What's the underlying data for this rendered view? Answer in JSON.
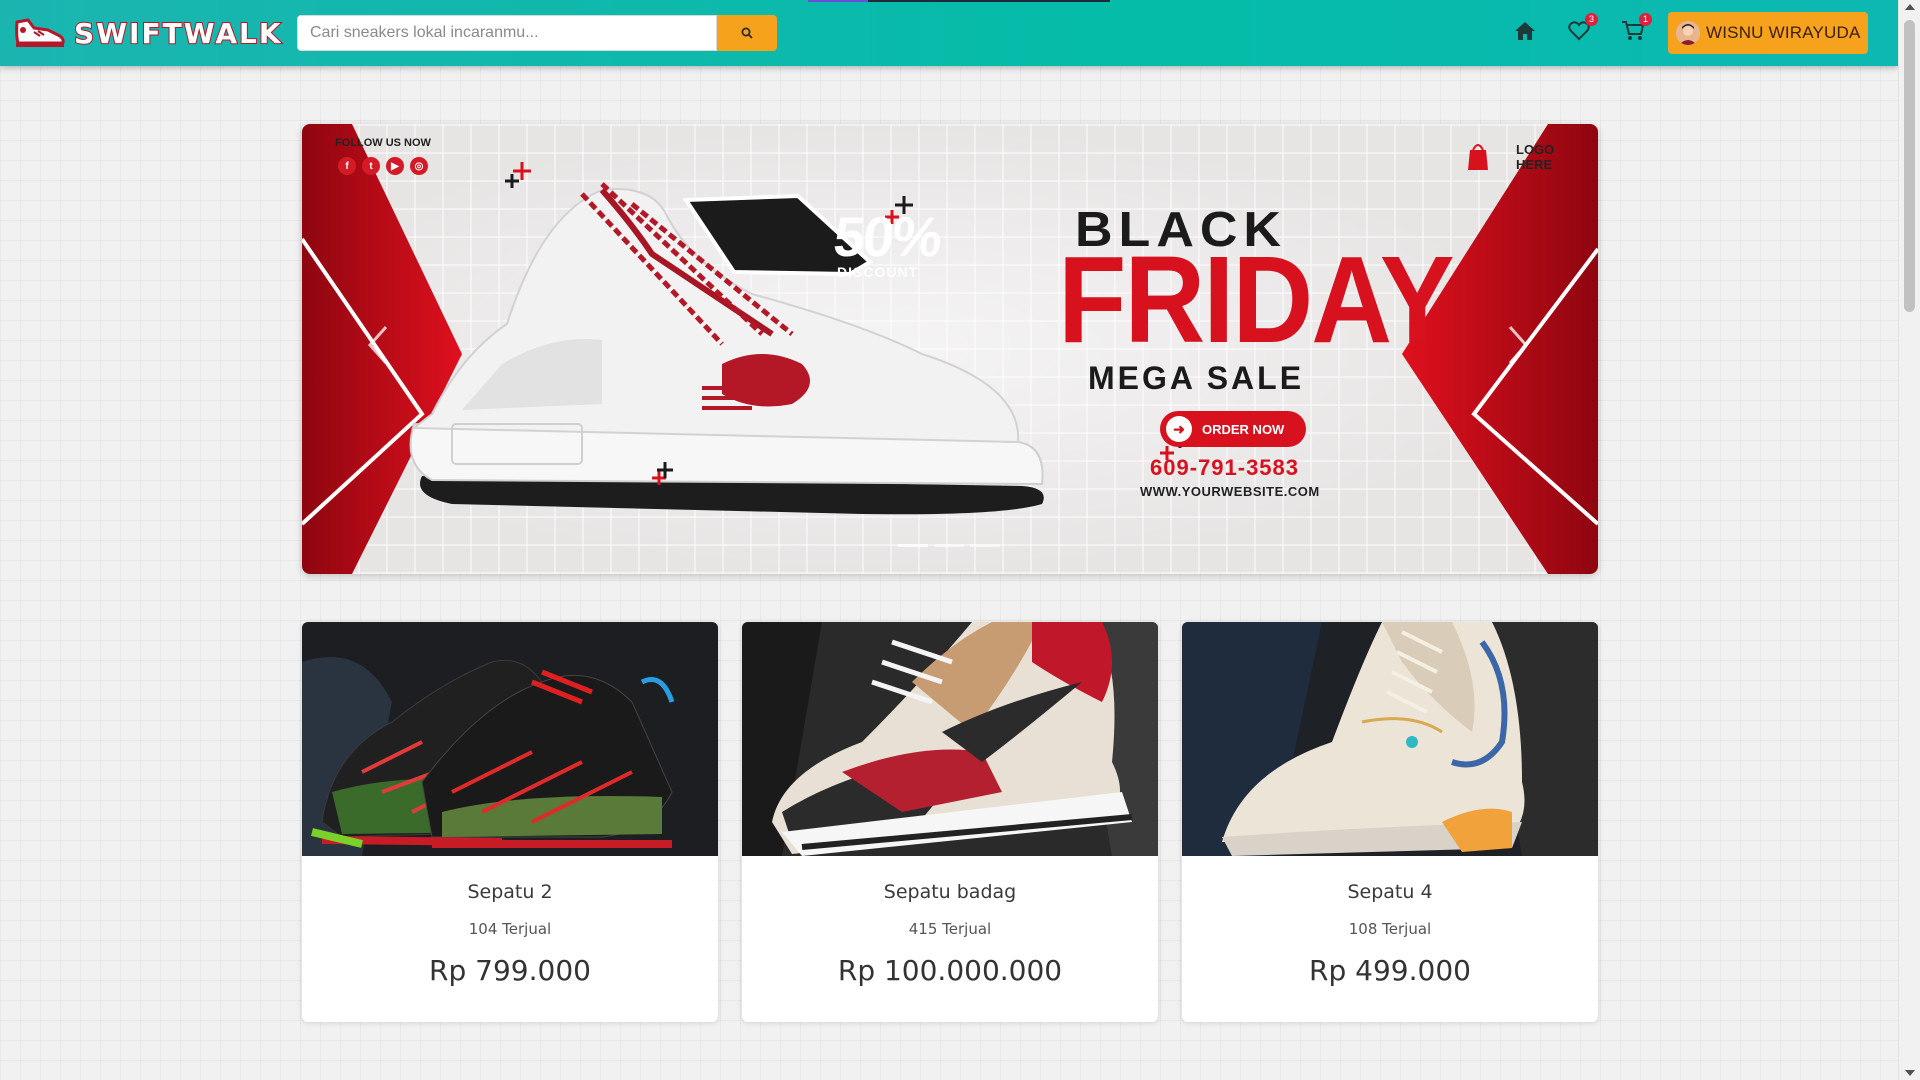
{
  "navbar": {
    "brand": "SWIFTWALK",
    "search": {
      "placeholder": "Cari sneakers lokal incaranmu...",
      "value": ""
    },
    "icons": [
      {
        "name": "home-icon"
      },
      {
        "name": "heart-icon",
        "badge": "3"
      },
      {
        "name": "cart-icon",
        "badge": "1"
      }
    ],
    "user": {
      "name": "WISNU WIRAYUDA"
    }
  },
  "banner": {
    "follow": "FOLLOW US NOW",
    "socials": [
      "f",
      "t",
      "▶",
      "◎"
    ],
    "logo": [
      "LOGO",
      "HERE"
    ],
    "discount_value": "50%",
    "discount_label": "DISCOUNT",
    "headline_1": "BLACK",
    "headline_2": "FRIDAY",
    "subheadline": "MEGA SALE",
    "cta": "ORDER NOW",
    "phone": "609-791-3583",
    "website": "WWW.YOURWEBSITE.COM",
    "slides": 3,
    "active_slide": 0
  },
  "products": [
    {
      "name": "Sepatu 2",
      "sold": "104 Terjual",
      "price": "Rp 799.000"
    },
    {
      "name": "Sepatu badag",
      "sold": "415 Terjual",
      "price": "Rp 100.000.000"
    },
    {
      "name": "Sepatu 4",
      "sold": "108 Terjual",
      "price": "Rp 499.000"
    }
  ],
  "colors": {
    "navbar": "#04bca8",
    "accent": "#f7a21c",
    "brand_red": "#d8111f",
    "badge": "#e0203c"
  }
}
